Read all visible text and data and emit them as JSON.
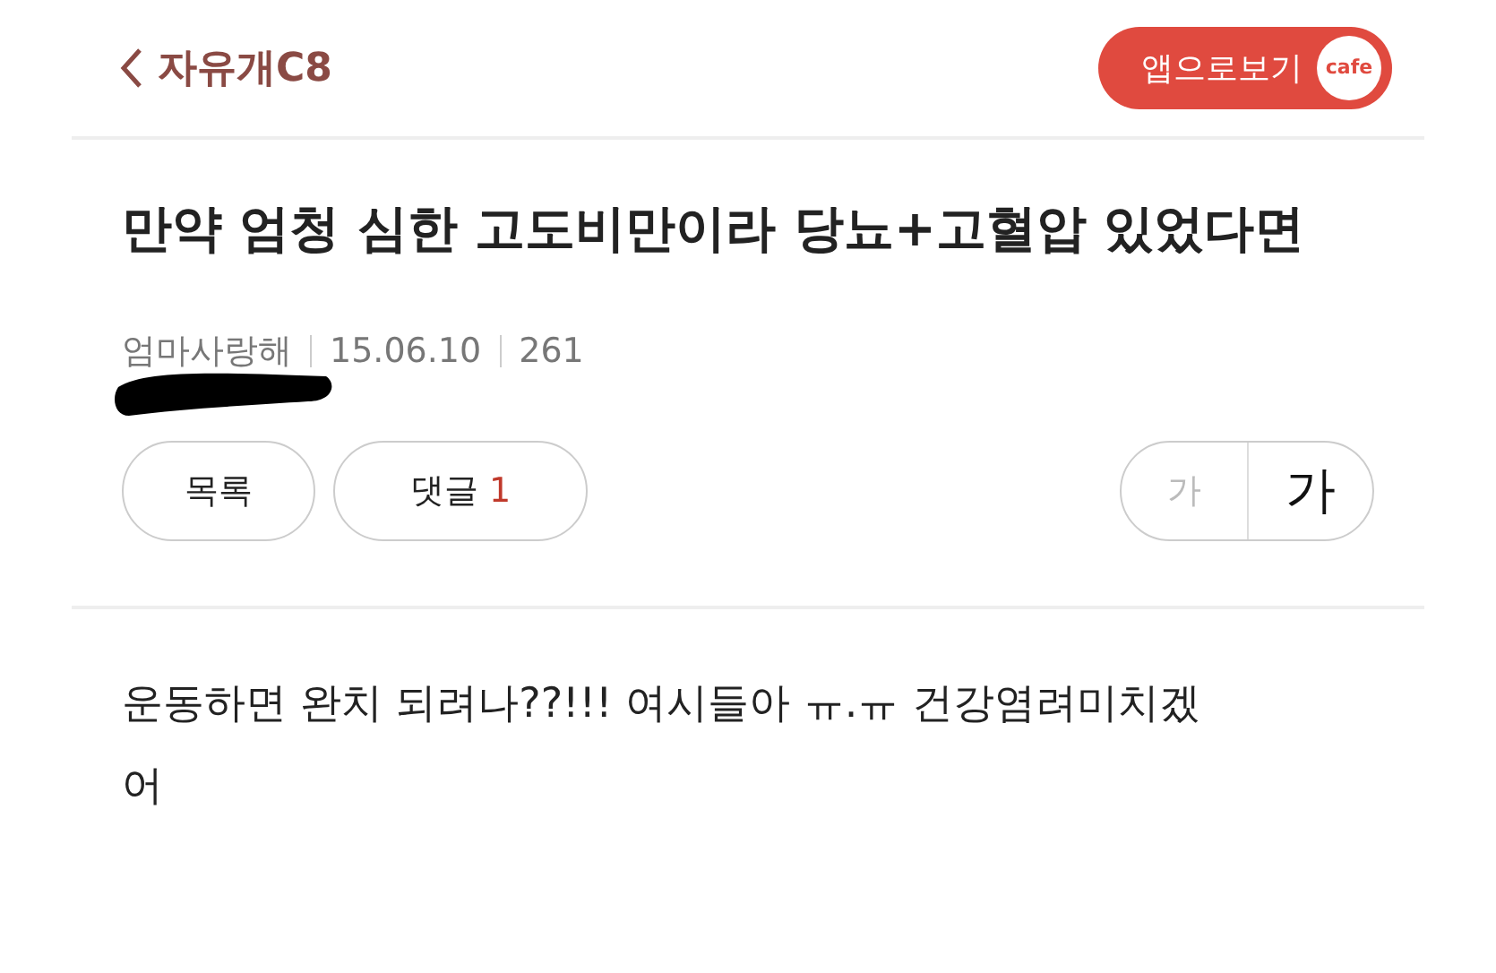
{
  "header": {
    "back_label": "자유개C8",
    "app_button": "앱으로보기",
    "app_badge": "cafe"
  },
  "post": {
    "title": "만약 엄청 심한 고도비만이라 당뇨+고혈압 있었다면",
    "author": "엄마사랑해",
    "date": "15.06.10",
    "views": "261"
  },
  "actions": {
    "list_button": "목록",
    "comment_label": "댓글",
    "comment_count": "1"
  },
  "font_size_options": [
    {
      "label": "가",
      "selected": false
    },
    {
      "label": "가",
      "selected": true
    }
  ],
  "body": "운동하면 완치 되려나??!!! 여시들아 ㅠ.ㅠ 건강염려미치겠어"
}
